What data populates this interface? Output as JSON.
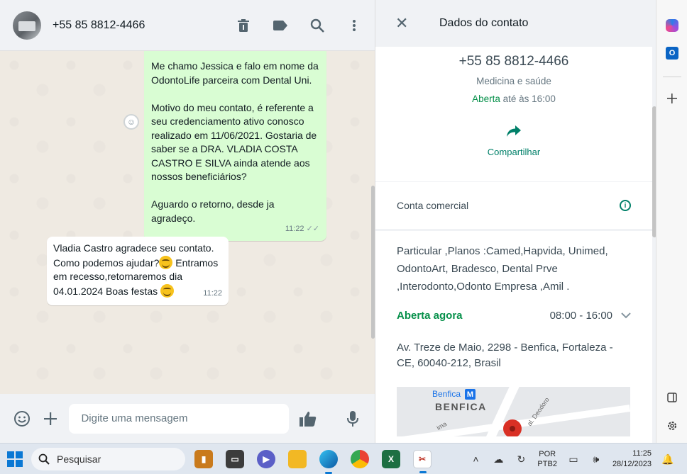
{
  "chat": {
    "title": "+55 85 8812-4466",
    "messages": {
      "outgoing": {
        "text": "Me chamo Jessica e falo em nome da OdontoLife parceira com Dental Uni.\n\nMotivo do meu contato, é referente a seu credenciamento ativo conosco realizado em 11/06/2021. Gostaria de saber se a DRA. VLADIA COSTA CASTRO E SILVA ainda atende aos nossos beneficiários?\n\nAguardo o retorno, desde ja agradeço.",
        "time": "11:22"
      },
      "incoming": {
        "text_part1": "Vladia Castro agradece seu contato. Como podemos ajudar?",
        "text_part2": " Entramos em recesso,retornaremos  dia 04.01.2024 Boas festas ",
        "time": "11:22"
      }
    },
    "composer": {
      "placeholder": "Digite uma mensagem"
    }
  },
  "contact_panel": {
    "title": "Dados do contato",
    "phone": "+55 85 8812-4466",
    "category": "Medicina e saúde",
    "status_open": "Aberta",
    "status_until": " até às 16:00",
    "share_label": "Compartilhar",
    "business_account_label": "Conta comercial",
    "description": "Particular ,Planos :Camed,Hapvida, Unimed, OdontoArt, Bradesco, Dental Prve ,Interodonto,Odonto Empresa ,Amil .",
    "open_now": "Aberta agora",
    "hours_range": "08:00 - 16:00",
    "address": "Av. Treze de Maio, 2298 - Benfica, Fortaleza - CE, 60040-212, Brasil",
    "map": {
      "label_small": "Benfica",
      "metro_badge": "M",
      "label_big": "BENFICA",
      "street_a": "ima",
      "street_b": "al. Deodoro"
    }
  },
  "taskbar": {
    "search_placeholder": "Pesquisar",
    "language_top": "POR",
    "language_bottom": "PTB2",
    "time": "11:25",
    "date": "28/12/2023"
  },
  "colors": {
    "accent_green": "#008069",
    "open_green": "#06904a",
    "outgoing_bubble": "#d9fdd3"
  }
}
